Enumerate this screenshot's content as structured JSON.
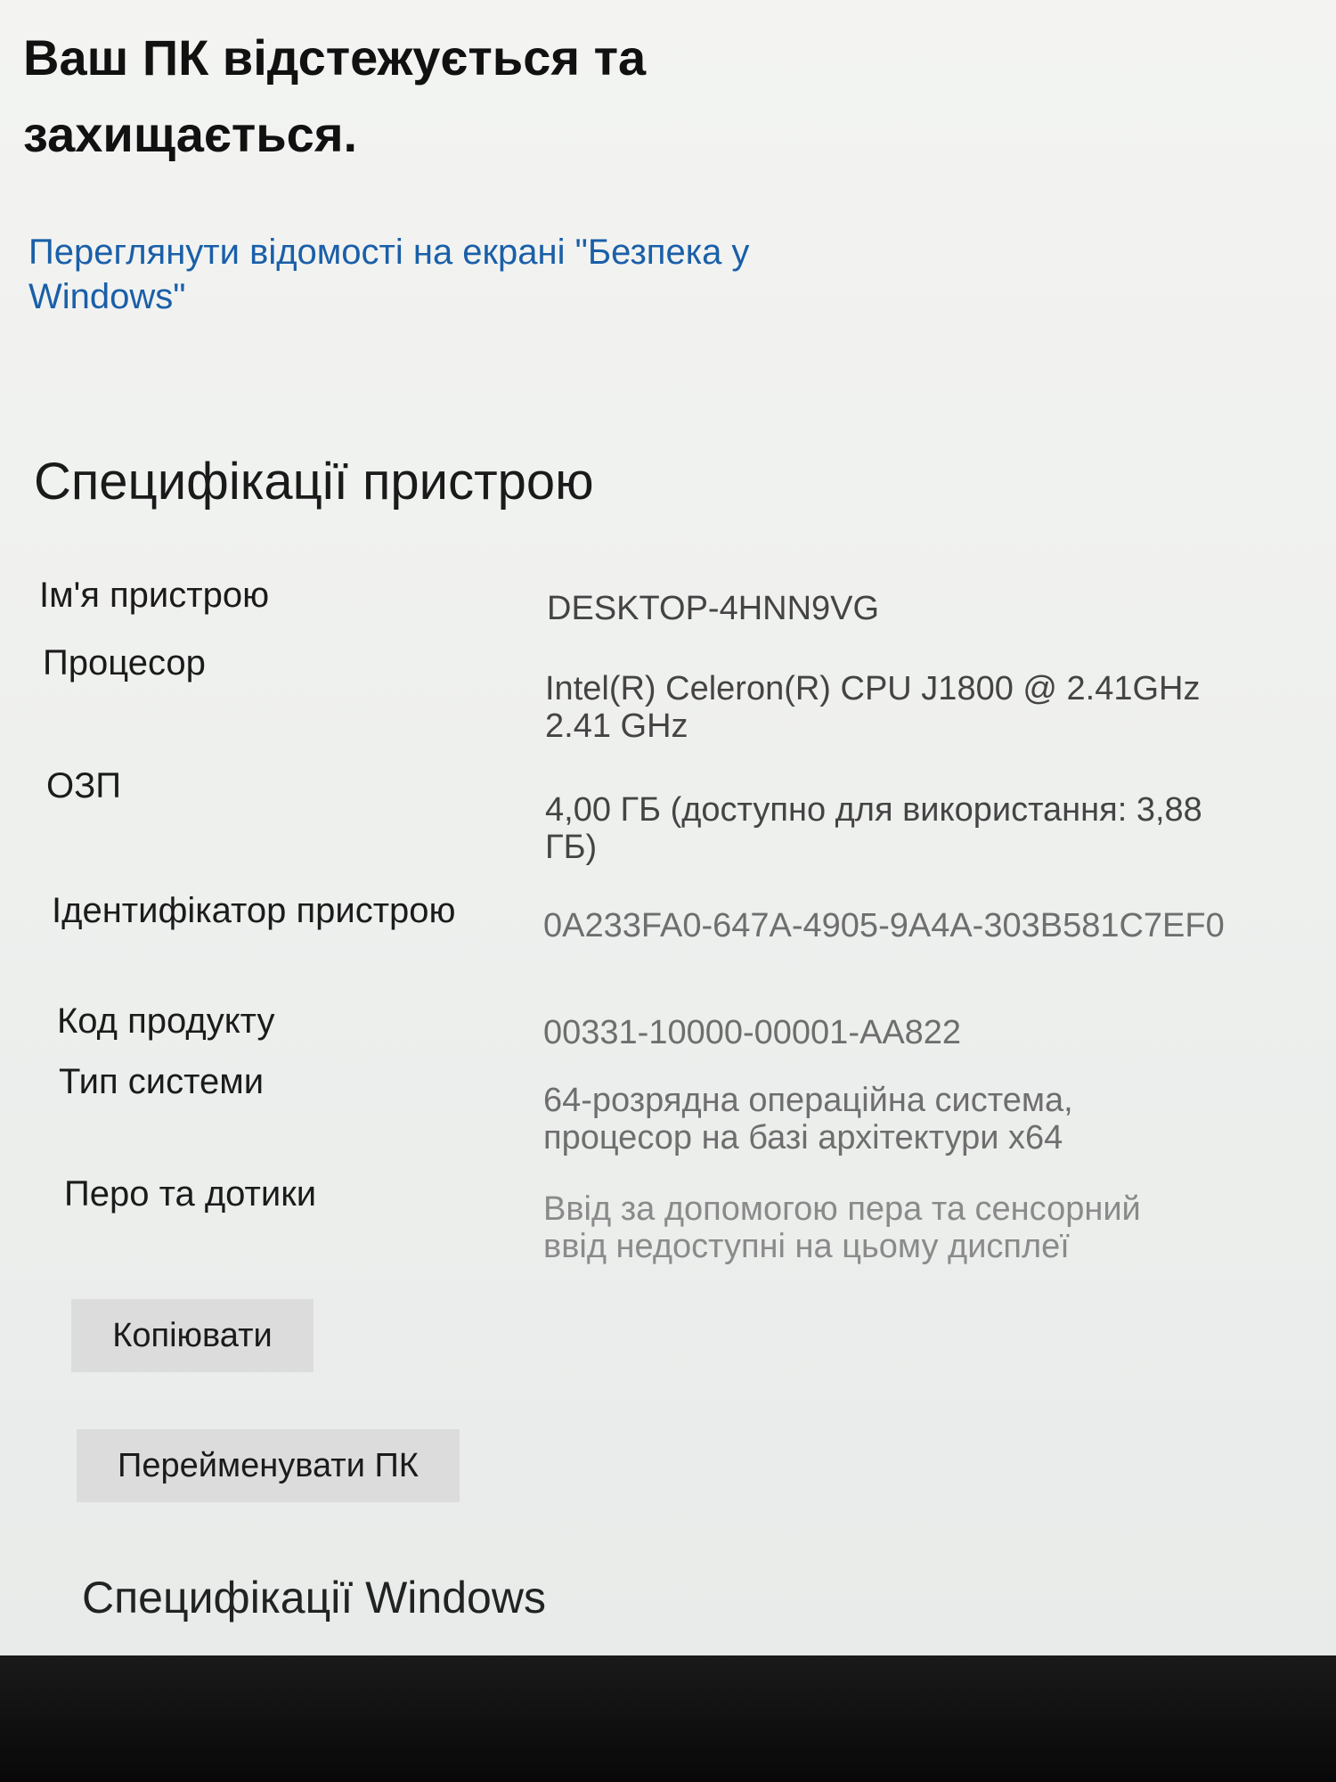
{
  "protection": {
    "status_title": "Ваш ПК відстежується та захищається.",
    "security_link": "Переглянути відомості на екрані \"Безпека у Windows\""
  },
  "device_specs": {
    "heading": "Специфікації пристрою",
    "rows": [
      {
        "label": "Ім'я пристрою",
        "value": "DESKTOP-4HNN9VG"
      },
      {
        "label": "Процесор",
        "value": "Intel(R) Celeron(R) CPU  J1800  @ 2.41GHz   2.41 GHz"
      },
      {
        "label": "ОЗП",
        "value": "4,00 ГБ (доступно для використання: 3,88 ГБ)"
      },
      {
        "label": "Ідентифікатор пристрою",
        "value": "0A233FA0-647A-4905-9A4A-303B581C7EF0"
      },
      {
        "label": "Код продукту",
        "value": "00331-10000-00001-AA822"
      },
      {
        "label": "Тип системи",
        "value": "64-розрядна операційна система, процесор на базі архітектури x64"
      },
      {
        "label": "Перо та дотики",
        "value": "Ввід за допомогою пера та сенсорний ввід недоступні на цьому дисплеї"
      }
    ],
    "copy_label": "Копіювати",
    "rename_label": "Перейменувати ПК"
  },
  "windows_specs": {
    "heading": "Специфікації Windows"
  }
}
